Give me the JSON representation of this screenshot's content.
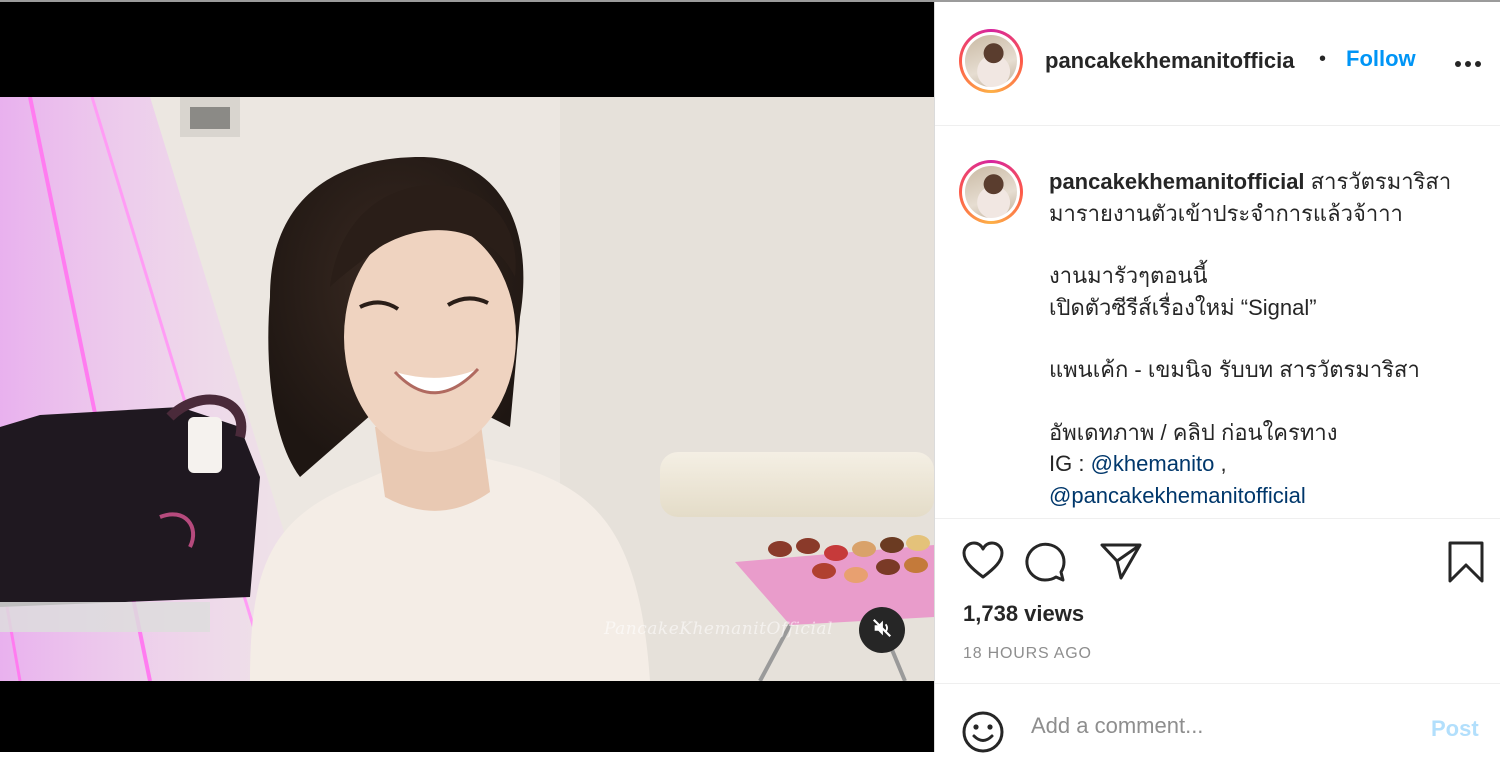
{
  "post": {
    "username": "pancakekhemanitofficia",
    "separator": "•",
    "follow_label": "Follow",
    "more_icon": "more-horizontal-icon"
  },
  "caption": {
    "username": "pancakekhemanitofficial",
    "line1": "สารวัตรมาริสา",
    "line2": "มารายงานตัวเข้าประจำการแล้วจ้าาา",
    "line3": "งานมารัวๆตอนนี้",
    "line4": "เปิดตัวซีรีส์เรื่องใหม่ “Signal”",
    "line5": "แพนเค้ก - เขมนิจ รับบท สารวัตรมาริสา",
    "line6": "อัพเดทภาพ / คลิป ก่อนใครทาง",
    "line7_prefix": "IG : ",
    "mention1": "@khemanito",
    "line7_suffix": " ,",
    "mention2": "@pancakekhemanitofficial"
  },
  "video": {
    "watermark": "PancakeKhemanitOfficial",
    "mute_icon": "muted-speaker-icon"
  },
  "stats": {
    "views": "1,738 views",
    "time": "18 HOURS AGO"
  },
  "comment": {
    "placeholder": "Add a comment...",
    "post_label": "Post"
  },
  "colors": {
    "accent": "#0095f6",
    "post_disabled": "#b2dffc",
    "mention": "#00376b"
  }
}
